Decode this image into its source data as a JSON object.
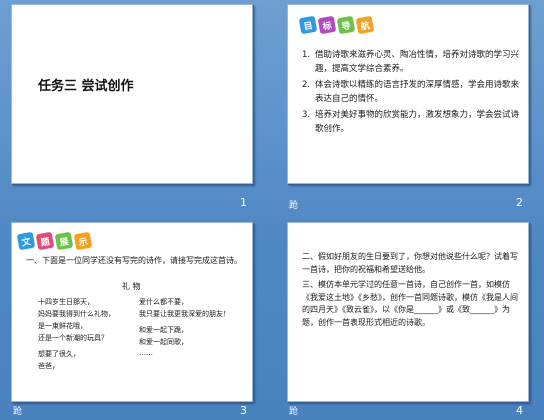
{
  "slide1": {
    "title": "任务三 尝试创作",
    "number": "1"
  },
  "slide2": {
    "badges": [
      {
        "text": "目",
        "color": "#2e9be0"
      },
      {
        "text": "标",
        "color": "#b447c4"
      },
      {
        "text": "导",
        "color": "#6dc24a"
      },
      {
        "text": "航",
        "color": "#f4a11f"
      }
    ],
    "items": [
      {
        "num": "1.",
        "text": "借助诗歌来滋养心灵、陶冶性情，培养对诗歌的学习兴趣，提高文学综合素养。"
      },
      {
        "num": "2.",
        "text": "体会诗歌以精练的语言抒发的深厚情感，学会用诗歌来表达自己的情怀。"
      },
      {
        "num": "3.",
        "text": "培养对美好事物的欣赏能力，激发想象力，学会尝试诗歌创作。"
      }
    ],
    "note": "跄",
    "number": "2"
  },
  "slide3": {
    "badges": [
      {
        "text": "文",
        "color": "#2e9be0"
      },
      {
        "text": "题",
        "color": "#e04b7a"
      },
      {
        "text": "展",
        "color": "#6dc24a"
      },
      {
        "text": "示",
        "color": "#f4a11f"
      }
    ],
    "intro": "一、下面是一位同学还没有写完的诗作，请接写完成这首诗。",
    "poem_title": "礼  物",
    "left_lines": [
      "十四岁生日那天，",
      "妈妈要我得到什么礼物，",
      "是一束鲜花哦，",
      "还是一个新潮的玩具？",
      "想要了很久，",
      "爸爸，"
    ],
    "right_lines": [
      "爱什么都不要，",
      "我只要让我更我深爱的朋友！",
      "和爱一起下跪，",
      "和爱一起同歌，",
      "……"
    ],
    "note": "跄",
    "number": "3"
  },
  "slide4": {
    "paragraphs": [
      "二、假如好朋友的生日要到了，你想对他说些什么呢？试着写一首诗，把你的祝福和希望送给他。",
      "三、模仿本单元学过的任意一首诗，自己创作一首，如模仿《我爱这土地》《乡愁》，创作一首同题诗歌，模仿《我是人间的四月天》《致云雀》，以《你是______》或《致______》为题，创作一首表现形式相近的诗歌。"
    ],
    "note": "跄",
    "number": "4"
  }
}
